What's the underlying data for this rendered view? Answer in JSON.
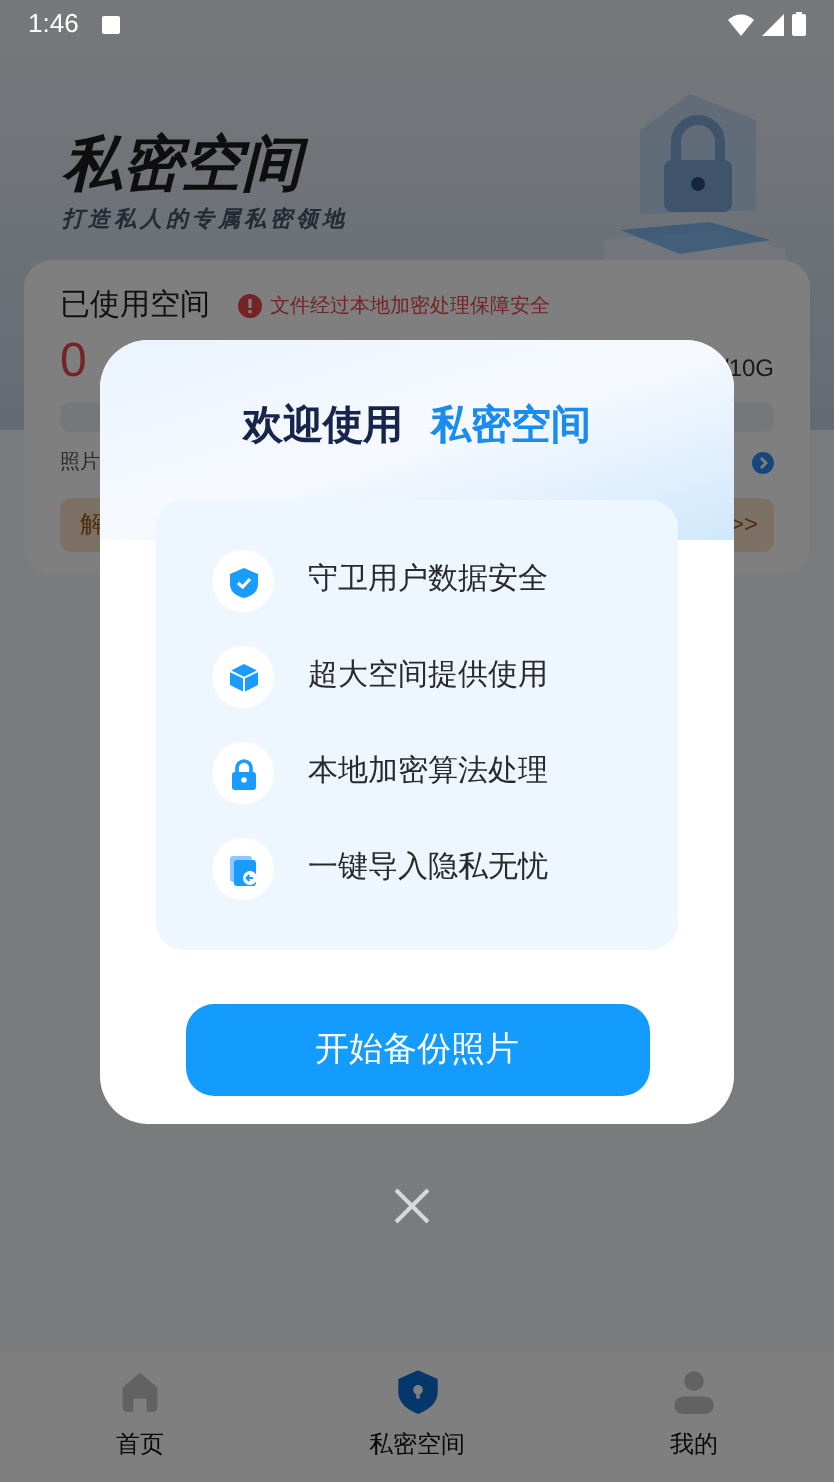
{
  "status_bar": {
    "time": "1:46"
  },
  "header": {
    "title": "私密空间",
    "subtitle": "打造私人的专属私密领地"
  },
  "usage_card": {
    "label": "已使用空间",
    "notice": "文件经过本地加密处理保障安全",
    "percent": "0",
    "capacity": "/10G",
    "level": 0,
    "left_caption": "照片",
    "left_button": "解",
    "right_button": ">>"
  },
  "dialog": {
    "title": "欢迎使用",
    "title_highlight": "私密空间",
    "features": [
      {
        "kind": "shield",
        "text": "守卫用户数据安全"
      },
      {
        "kind": "cube",
        "text": "超大空间提供使用"
      },
      {
        "kind": "lock",
        "text": "本地加密算法处理"
      },
      {
        "kind": "import",
        "text": "一键导入隐私无忧"
      }
    ],
    "button": "开始备份照片"
  },
  "nav": [
    {
      "kind": "home",
      "label": "首页",
      "selected": false
    },
    {
      "kind": "vault",
      "label": "私密空间",
      "selected": true
    },
    {
      "kind": "profile",
      "label": "我的",
      "selected": false
    }
  ]
}
